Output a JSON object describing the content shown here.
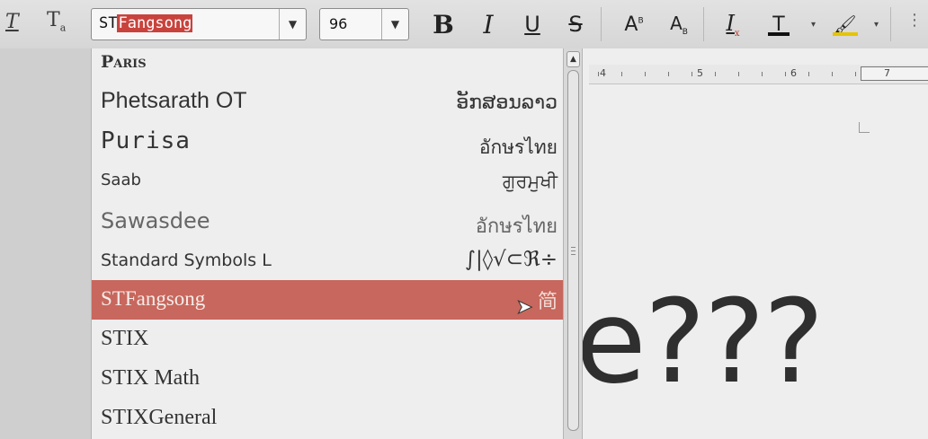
{
  "toolbar": {
    "font_name": {
      "prefix": "ST",
      "selected": "Fangsong"
    },
    "font_size": "96",
    "bold_label": "B",
    "italic_label": "I",
    "underline_label": "U",
    "strike_label": "S",
    "superscript_label": "A",
    "subscript_label": "A",
    "clear_format_label": "I",
    "font_color_label": "T",
    "dropdown_glyph": "▾",
    "icons": [
      "clear-direct-formatting-icon",
      "character-style-icon",
      "font-color-icon",
      "highlight-icon",
      "more-icon"
    ],
    "highlight_color": "#e6c400"
  },
  "font_list": {
    "items": [
      {
        "name": "Paris",
        "sample": ""
      },
      {
        "name": "Phetsarath OT",
        "sample": "ອັກສອນລາວ"
      },
      {
        "name": "Purisa",
        "sample": "อักษรไทย"
      },
      {
        "name": "Saab",
        "sample": "ਗੁਰਮੁਖੀ"
      },
      {
        "name": "Sawasdee",
        "sample": "อักษรไทย"
      },
      {
        "name": "Standard Symbols L",
        "sample": "∫|◊√⊂ℜ÷"
      },
      {
        "name": "STFangsong",
        "sample": "简"
      },
      {
        "name": "STIX",
        "sample": ""
      },
      {
        "name": "STIX Math",
        "sample": ""
      },
      {
        "name": "STIXGeneral",
        "sample": ""
      }
    ],
    "selected_index": 6,
    "selected_color": "#c8675d"
  },
  "ruler": {
    "labels": [
      "4",
      "5",
      "6",
      "7"
    ]
  },
  "document": {
    "text": "e???"
  }
}
